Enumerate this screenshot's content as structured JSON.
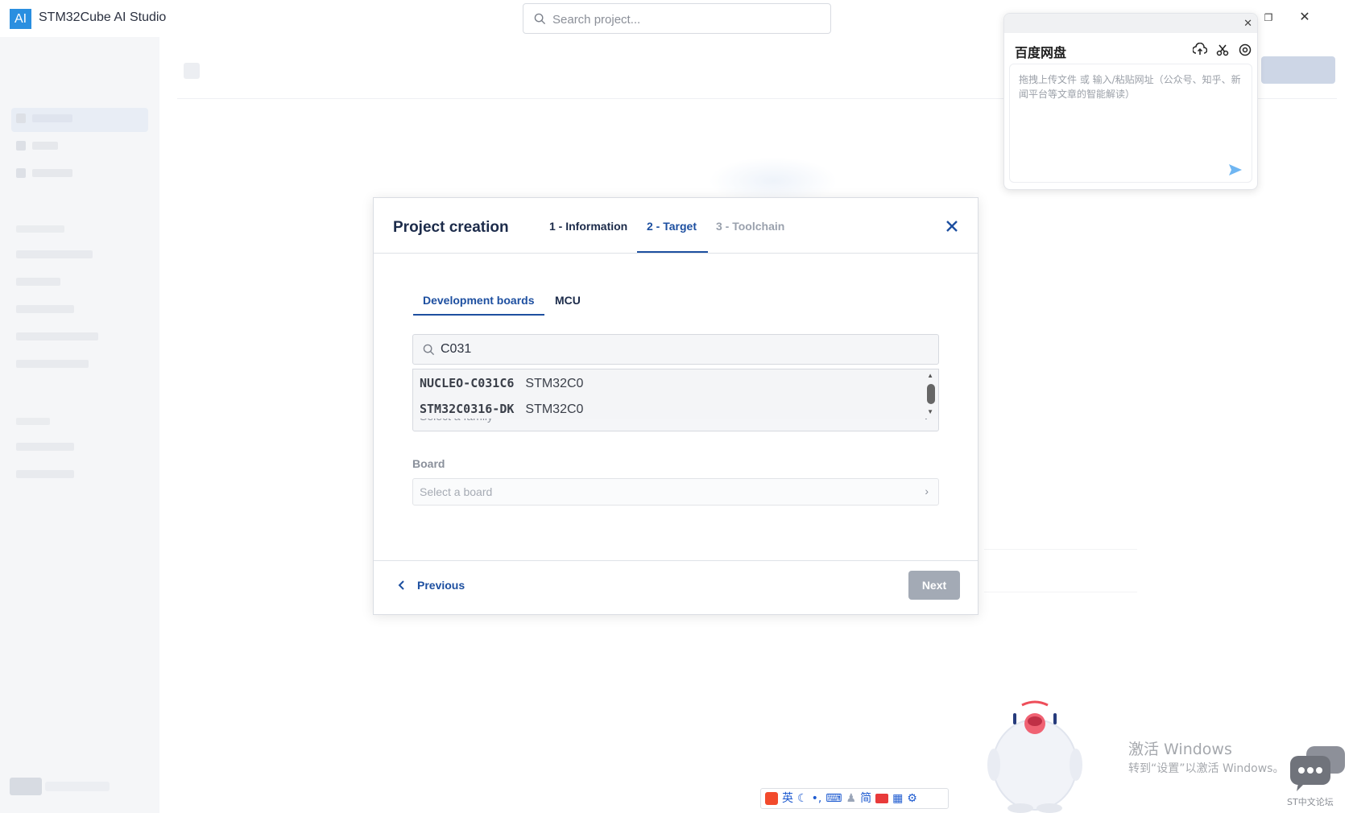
{
  "app": {
    "logo": "AI",
    "title": "STM32Cube AI Studio",
    "search_placeholder": "Search project..."
  },
  "window_controls": [
    "-",
    "❐",
    "✕"
  ],
  "modal": {
    "title": "Project creation",
    "steps": [
      "1 - Information",
      "2 - Target",
      "3 - Toolchain"
    ],
    "active_step": "2 - Target",
    "subtabs": [
      "Development boards",
      "MCU"
    ],
    "active_subtab": "Development boards",
    "filter_value": "C031",
    "dropdown_results": [
      {
        "code": "NUCLEO-C031C6",
        "family": "STM32C0"
      },
      {
        "code": "STM32C0316-DK",
        "family": "STM32C0"
      }
    ],
    "family_placeholder": "Select a family",
    "board_label": "Board",
    "board_placeholder": "Select a board",
    "previous_label": "Previous",
    "next_label": "Next"
  },
  "baidu": {
    "title": "百度网盘",
    "placeholder": "拖拽上传文件 或 输入/粘贴网址（公众号、知乎、新闻平台等文章的智能解读）"
  },
  "watermark": {
    "line1": "激活 Windows",
    "line2": "转到“设置”以激活 Windows。"
  },
  "forum_label": "ST中文论坛",
  "ime": {
    "lang": "英",
    "mode": "简"
  },
  "colors": {
    "accent": "#1d4fa0",
    "title_text": "#1c2b4a",
    "next_disabled": "#a3aab5",
    "logo_blue": "#2a8fe0"
  }
}
